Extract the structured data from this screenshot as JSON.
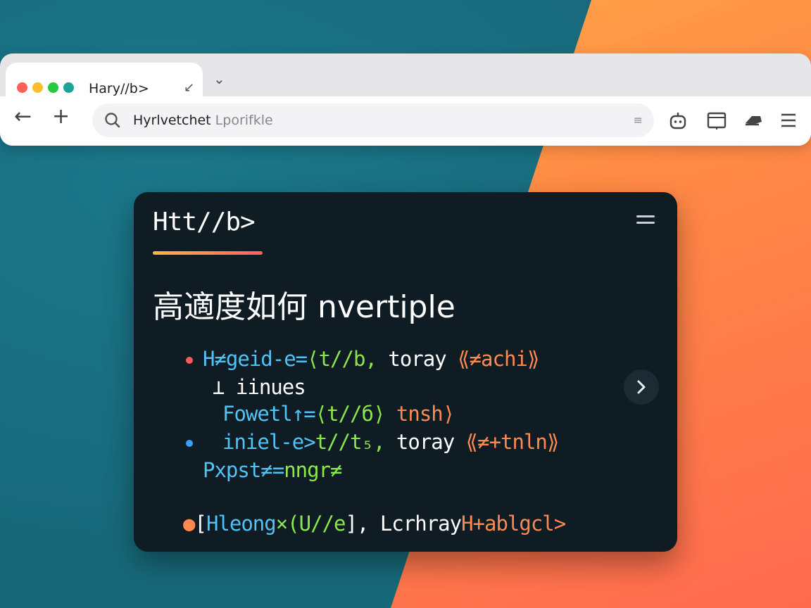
{
  "window": {
    "tab_title": "Hary//b>",
    "tab_close_glyph": "↙",
    "new_tab_glyph": "⌄",
    "traffic_lights": [
      "#ff5f57",
      "#febc2e",
      "#28c840",
      "#19a39a"
    ]
  },
  "toolbar": {
    "back_glyph": "←",
    "add_glyph": "+",
    "url_text": "Hyrlvetchet",
    "url_hint": " Lporifkle",
    "url_end_glyph": "≡",
    "icons": [
      "extension-icon",
      "reader-icon",
      "cloud-icon",
      "menu-icon"
    ]
  },
  "card": {
    "title": "Htt//b>",
    "heading": "高適度如何  nvertiple",
    "lines": {
      "l1a": "H≠geid-e=",
      "l1b": "⟨t//b,",
      "l1c": " toray ",
      "l1d": "⟪≠achi⟫",
      "l2": "⊥ iinues",
      "l3a": "Fowetl↑=",
      "l3b": "⟨t//б⟩",
      "l3c": " tnsh⟩",
      "l4a": "iniel-e>",
      "l4b": "t//t₅,",
      "l4c": " toray ",
      "l4d": "⟪≠+tnln⟫",
      "l5a": "Pxpst≠=",
      "l5b": "nngr≠",
      "l6a": "[",
      "l6b": "Hleong",
      "l6c": "×(U//e",
      "l6d": "], Lcrhray",
      "l6e": "H+ablgcl>"
    }
  },
  "colors": {
    "teal_bg": "#17697a",
    "orange_bg": "#ff8a45",
    "card_bg": "#0f1c24",
    "code_blue": "#4fc3f7",
    "code_green": "#8be84a",
    "code_orange": "#ff8a50"
  }
}
